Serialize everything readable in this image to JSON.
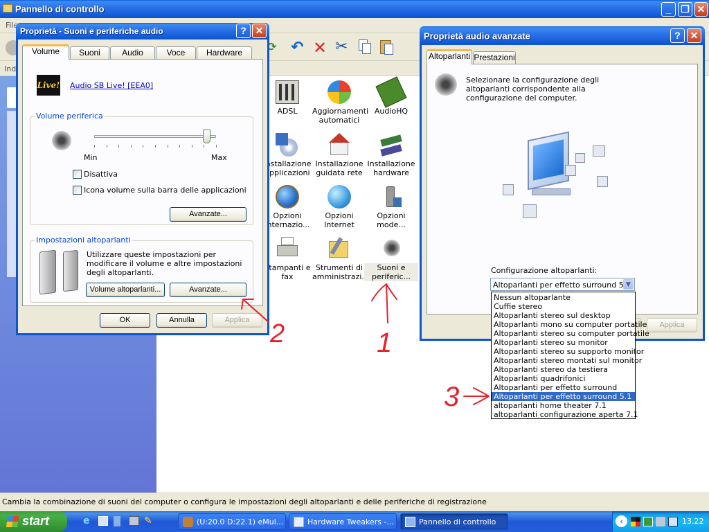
{
  "main_window": {
    "title": "Pannello di controllo",
    "menu_partial": "File",
    "address_partial": "Ind",
    "status_bar": "Cambia la combinazione di suoni del computer o configura le impostazioni degli altoparlanti e delle periferiche di registrazione"
  },
  "control_panel_items": [
    {
      "label": "ADSL",
      "icon": "adsl-icon"
    },
    {
      "label": "Aggiornamenti automatici",
      "icon": "windows-update-icon"
    },
    {
      "label": "AudioHQ",
      "icon": "audiohq-icon"
    },
    {
      "label": "Installazione applicazioni",
      "icon": "add-remove-programs-icon"
    },
    {
      "label": "Installazione guidata rete",
      "icon": "network-setup-icon"
    },
    {
      "label": "Installazione hardware",
      "icon": "add-hardware-icon"
    },
    {
      "label": "Opzioni internazio...",
      "icon": "globe-icon"
    },
    {
      "label": "Opzioni Internet",
      "icon": "internet-options-icon"
    },
    {
      "label": "Opzioni mode...",
      "icon": "modem-icon"
    },
    {
      "label": "Stampanti e fax",
      "icon": "printer-icon"
    },
    {
      "label": "Strumenti di amministrazi...",
      "icon": "admin-tools-icon"
    },
    {
      "label": "Suoni e periferic...",
      "icon": "speaker-icon"
    }
  ],
  "sound_dialog": {
    "title": "Proprietà - Suoni e periferiche audio",
    "tabs": [
      "Volume",
      "Suoni",
      "Audio",
      "Voce",
      "Hardware"
    ],
    "device_name": "Audio SB Live! [EEA0]",
    "logo_text": "Live!",
    "volume_group_label": "Volume periferica",
    "slider_min": "Min",
    "slider_max": "Max",
    "volume_level": 0.92,
    "mute_label": "Disattiva",
    "tray_icon_label": "Icona volume sulla barra delle applicazioni",
    "advanced1_label": "Avanzate...",
    "speaker_group_label": "Impostazioni altoparlanti",
    "speaker_desc": "Utilizzare queste impostazioni per modificare il volume e altre impostazioni degli altoparlanti.",
    "speaker_volume_label": "Volume altoparlanti...",
    "advanced2_label": "Avanzate...",
    "ok_label": "OK",
    "cancel_label": "Annulla",
    "apply_label": "Applica"
  },
  "advanced_dialog": {
    "title": "Proprietà audio avanzate",
    "tabs": [
      "Altoparlanti",
      "Prestazioni"
    ],
    "description": "Selezionare la configurazione degli altoparlanti corrispondente alla configurazione del computer.",
    "config_label": "Configurazione altoparlanti:",
    "selected": "Altoparlanti per effetto surround 5.1",
    "options": [
      "Nessun altoparlante",
      "Cuffie stereo",
      "Altoparlanti stereo sul desktop",
      "Altoparlanti mono su computer portatile",
      "Altoparlanti stereo su computer portatile",
      "Altoparlanti stereo su monitor",
      "Altoparlanti stereo su supporto monitor",
      "Altoparlanti stereo montati sul monitor",
      "Altoparlanti stereo da testiera",
      "Altoparlanti quadrifonici",
      "Altoparlanti per effetto surround",
      "Altoparlanti per effetto surround 5.1",
      "altoparlanti home theater 7.1",
      "altoparlanti configurazione aperta 7.1"
    ],
    "selected_index": 11,
    "apply_label": "Applica"
  },
  "annotations": {
    "one": "1",
    "two": "2",
    "three": "3"
  },
  "taskbar": {
    "start_label": "start",
    "items": [
      "(U:20.0 D:22.1) eMul...",
      "Hardware Tweakers -...",
      "Pannello di controllo"
    ],
    "clock": "13.22"
  },
  "colors": {
    "xp_blue": "#0b55d3",
    "dialog_bg": "#ece9d8",
    "selection": "#316ac5",
    "annotation_red": "#e8202c"
  }
}
